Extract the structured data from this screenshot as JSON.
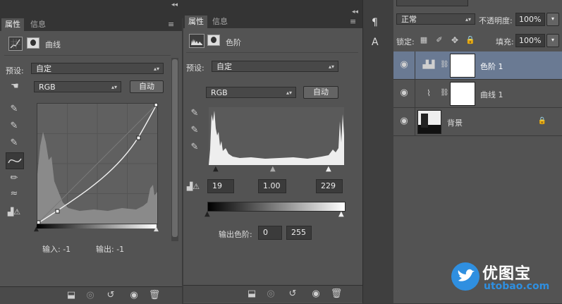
{
  "left_panel": {
    "tabs": [
      "属性",
      "信息"
    ],
    "header_title": "曲线",
    "preset_label": "预设:",
    "preset_value": "自定",
    "channel_value": "RGB",
    "auto_label": "自动",
    "input_label": "输入: -1",
    "output_label": "输出: -1"
  },
  "mid_panel": {
    "tabs": [
      "属性",
      "信息"
    ],
    "header_title": "色阶",
    "preset_label": "预设:",
    "preset_value": "自定",
    "channel_value": "RGB",
    "auto_label": "自动",
    "input_black": "19",
    "input_gamma": "1.00",
    "input_white": "229",
    "output_label": "输出色阶:",
    "output_black": "0",
    "output_white": "255"
  },
  "layers": {
    "blend_mode": "正常",
    "opacity_label": "不透明度:",
    "opacity_value": "100%",
    "lock_label": "锁定:",
    "fill_label": "填充:",
    "fill_value": "100%",
    "items": [
      {
        "name": "色阶 1",
        "selected": true
      },
      {
        "name": "曲线 1",
        "selected": false
      },
      {
        "name": "背景",
        "selected": false
      }
    ]
  },
  "watermark": {
    "title": "优图宝",
    "url": "utobao.com"
  },
  "colors": {
    "panel": "#535353",
    "selected_layer": "#6a7a93",
    "watermark_blue": "#2f8fe0"
  }
}
